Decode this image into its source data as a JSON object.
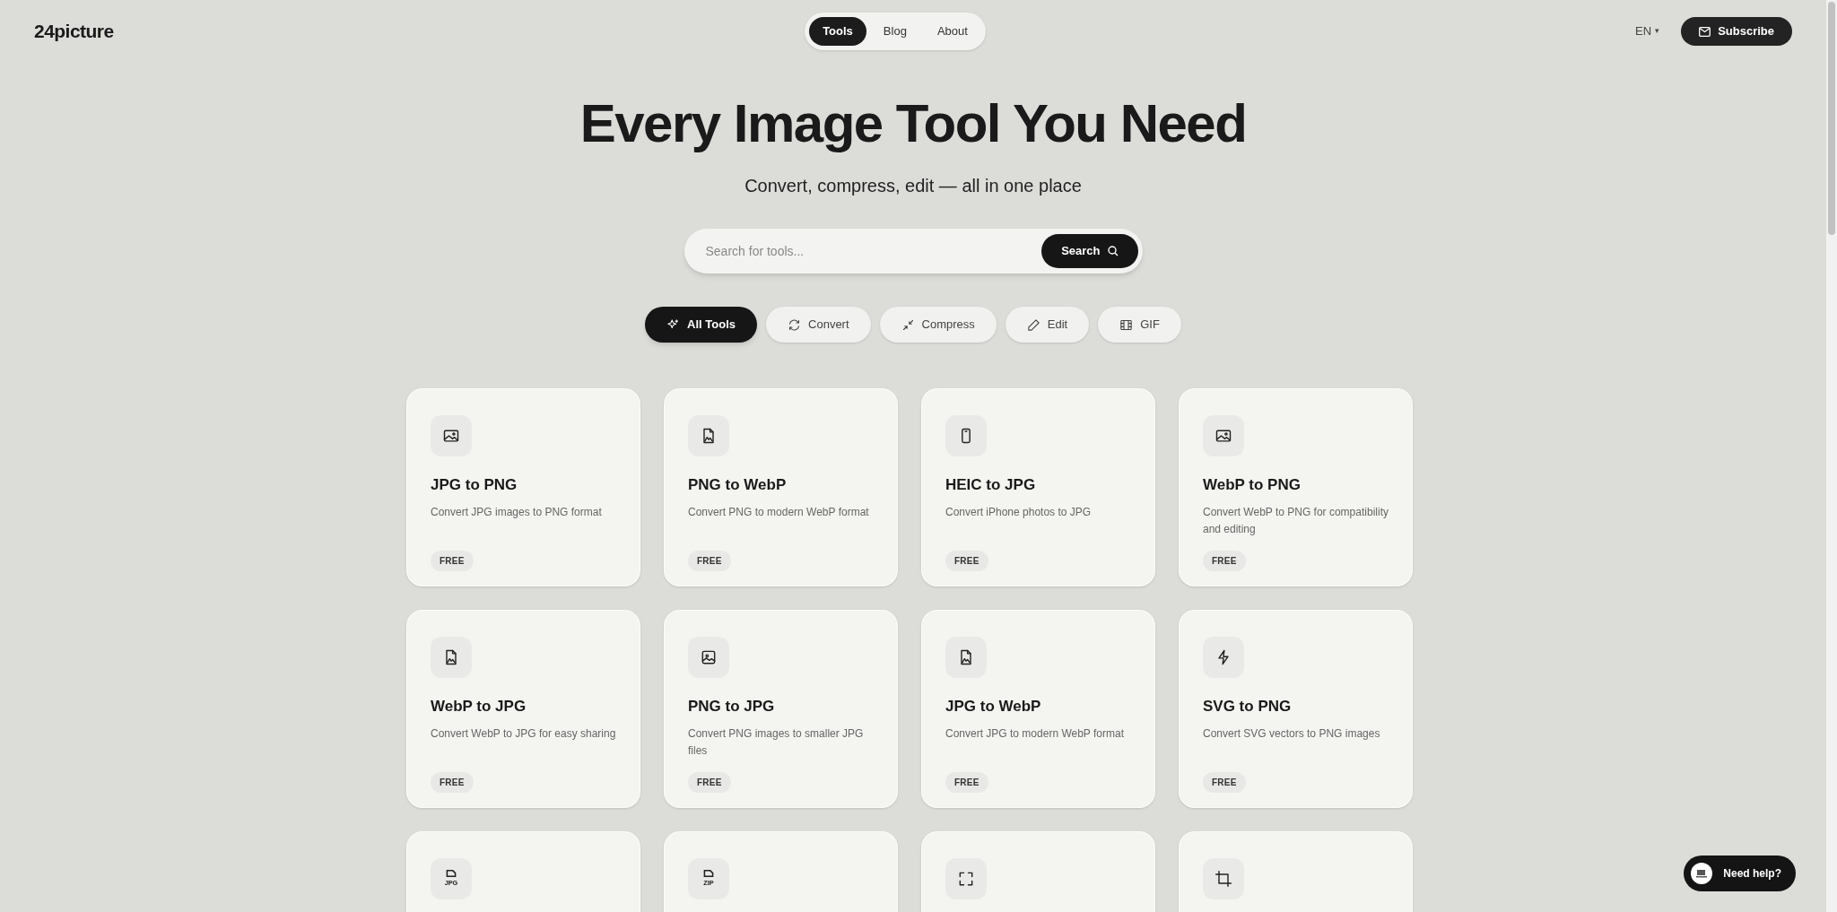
{
  "header": {
    "logo": "24picture",
    "nav": [
      {
        "label": "Tools",
        "selected": true
      },
      {
        "label": "Blog",
        "selected": false
      },
      {
        "label": "About",
        "selected": false
      }
    ],
    "language": "EN",
    "language_caret": "▾",
    "subscribe": "Subscribe"
  },
  "hero": {
    "title": "Every Image Tool You Need",
    "subtitle": "Convert, compress, edit — all in one place"
  },
  "search": {
    "placeholder": "Search for tools...",
    "button": "Search"
  },
  "filters": [
    {
      "label": "All Tools",
      "kind": "sparkle",
      "selected": true
    },
    {
      "label": "Convert",
      "kind": "refresh",
      "selected": false
    },
    {
      "label": "Compress",
      "kind": "compress",
      "selected": false
    },
    {
      "label": "Edit",
      "kind": "pencil",
      "selected": false
    },
    {
      "label": "GIF",
      "kind": "film",
      "selected": false
    }
  ],
  "tools": [
    {
      "kind": "image",
      "title": "JPG to PNG",
      "description": "Convert JPG images to PNG format",
      "badge": "FREE"
    },
    {
      "kind": "file-image",
      "title": "PNG to WebP",
      "description": "Convert PNG to modern WebP format",
      "badge": "FREE"
    },
    {
      "kind": "phone",
      "title": "HEIC to JPG",
      "description": "Convert iPhone photos to JPG",
      "badge": "FREE"
    },
    {
      "kind": "image",
      "title": "WebP to PNG",
      "description": "Convert WebP to PNG for compatibility and editing",
      "badge": "FREE"
    },
    {
      "kind": "file-image",
      "title": "WebP to JPG",
      "description": "Convert WebP to JPG for easy sharing",
      "badge": "FREE"
    },
    {
      "kind": "image-frame",
      "title": "PNG to JPG",
      "description": "Convert PNG images to smaller JPG files",
      "badge": "FREE"
    },
    {
      "kind": "file-image",
      "title": "JPG to WebP",
      "description": "Convert JPG to modern WebP format",
      "badge": "FREE"
    },
    {
      "kind": "bolt",
      "title": "SVG to PNG",
      "description": "Convert SVG vectors to PNG images",
      "badge": "FREE"
    },
    {
      "kind": "file-text",
      "icon_text": "JPG"
    },
    {
      "kind": "file-text",
      "icon_text": "ZIP"
    },
    {
      "kind": "expand"
    },
    {
      "kind": "crop"
    }
  ],
  "help_button": "Need help?"
}
